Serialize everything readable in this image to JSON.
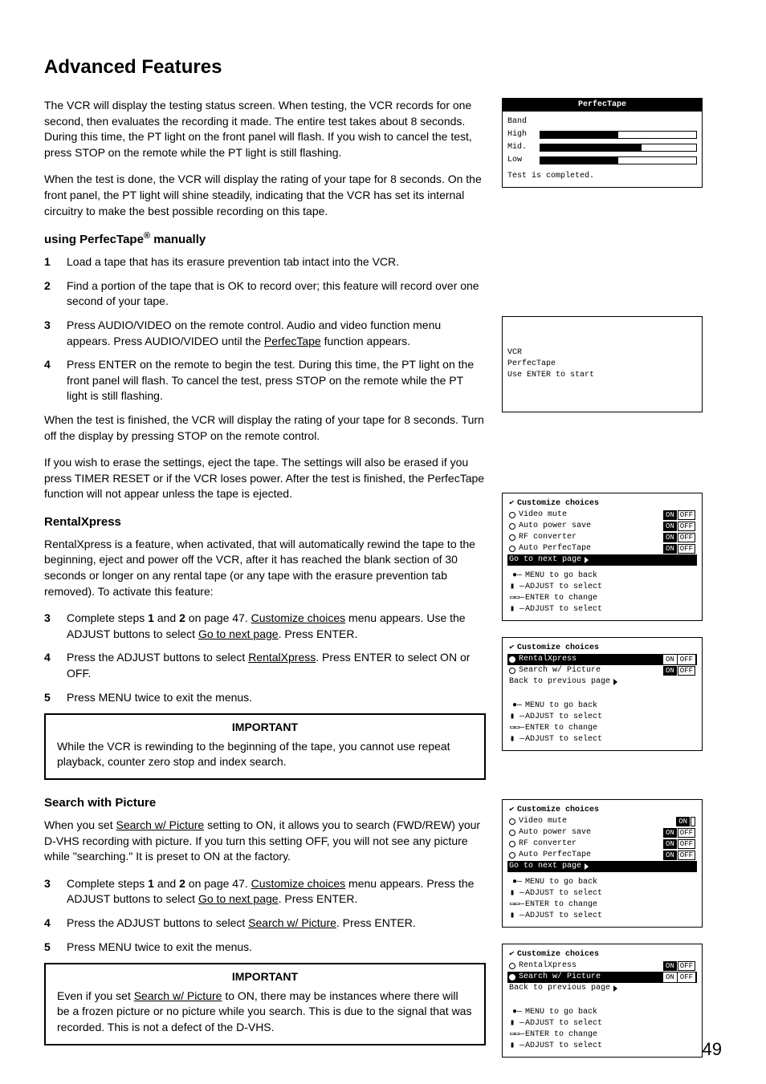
{
  "title": "Advanced Features",
  "page_number": "49",
  "intro": {
    "p1": "The VCR will display the testing status screen.  When testing, the VCR records for one second, then evaluates the recording it made.  The entire test takes about 8 seconds.  During this time, the PT light on the front panel will flash.  If you wish to cancel the test, press STOP on the remote while the PT light is still flashing.",
    "p2": "When the test is done, the VCR will display the rating of your tape for 8 seconds.  On the front panel, the PT light will shine steadily, indicating that the VCR has set its internal circuitry to make the best possible recording on this tape."
  },
  "perfectape": {
    "heading_prefix": "using PerfecTape",
    "reg": "®",
    "heading_suffix": " manually",
    "step1": "Load a tape that has its erasure prevention tab intact into the VCR.",
    "step2": "Find a portion of the tape that is OK to record over; this feature will record over one second of your tape.",
    "step3_pre": "Press AUDIO/VIDEO on the remote control.  Audio and video function menu appears.  Press AUDIO/VIDEO until the ",
    "step3_u": "PerfecTape",
    "step3_post": " function appears.",
    "step4": "Press ENTER on the remote to begin the test.  During this time, the PT light on the front panel will flash.  To cancel the test, press STOP on the remote while the PT light is still flashing.",
    "after1": "When the test is finished, the VCR will display the rating of your tape for 8 seconds.  Turn off the display by pressing STOP on the remote control.",
    "after2": "If you wish to erase the settings, eject the tape.  The settings will also be erased if you press TIMER RESET or if the VCR loses power.  After the test is finished, the PerfecTape function will not appear unless the tape is ejected."
  },
  "rentalxpress": {
    "heading": "RentalXpress",
    "intro": "RentalXpress is a feature, when activated, that will automatically rewind the tape to the beginning, eject and power off the VCR, after it has reached the blank section of 30 seconds or longer on any rental tape (or any tape with the erasure prevention tab removed).  To activate this feature:",
    "step3_pre": "Complete steps ",
    "step3_b1": "1",
    "step3_and": " and ",
    "step3_b2": "2",
    "step3_mid": " on page 47.  ",
    "step3_u1": "Customize choices",
    "step3_after_u1": " menu appears.  Use the ADJUST buttons to select ",
    "step3_u2": "Go to next page",
    "step3_end": ".  Press ENTER.",
    "step4_pre": "Press the ADJUST buttons to select ",
    "step4_u": "RentalXpress",
    "step4_post": ".  Press ENTER to select ON or OFF.",
    "step5": "Press MENU twice to exit the menus.",
    "important": "While the VCR is rewinding to the beginning of the tape, you cannot use repeat playback, counter zero stop and index search."
  },
  "search": {
    "heading": "Search with Picture",
    "intro_pre": "When you set ",
    "intro_u": "Search w/ Picture",
    "intro_post": " setting to ON, it allows you to search (FWD/REW) your D-VHS recording with picture.  If you turn this setting OFF, you will not see any picture while \"searching.\"  It is preset to ON at the factory.",
    "step3_pre": "Complete steps ",
    "step3_b1": "1",
    "step3_and": " and ",
    "step3_b2": "2",
    "step3_mid": " on page 47.  ",
    "step3_u1": "Customize choices",
    "step3_after_u1": " menu appears.  Press the ADJUST buttons to select ",
    "step3_u2": "Go to next page",
    "step3_end": ".  Press ENTER.",
    "step4_pre": "Press the ADJUST buttons to select ",
    "step4_u": "Search w/ Picture",
    "step4_post": ".  Press ENTER.",
    "step5": "Press MENU twice to exit the menus.",
    "important_pre": "Even if you set ",
    "important_u": "Search w/ Picture",
    "important_post": " to ON, there may be instances where there will be a frozen picture or no picture while you search.  This is due to the signal that was recorded.  This is not a defect of the D-VHS."
  },
  "important_label": "IMPORTANT",
  "nums": {
    "s1": "1",
    "s2": "2",
    "s3": "3",
    "s4": "4",
    "s5": "5"
  },
  "screens": {
    "pt": {
      "title": "PerfecTape",
      "band": "Band",
      "high": "High",
      "mid": "Mid.",
      "low": "Low",
      "done": "Test is completed."
    },
    "vcr": {
      "l1": "VCR",
      "l2": "PerfecTape",
      "l3": "Use ENTER to start"
    },
    "menu": {
      "header": "Customize choices",
      "video_mute": "Video mute",
      "auto_power": "Auto power save",
      "rf": "RF converter",
      "auto_pt": "Auto PerfecTape",
      "rentalxpress": "RentalXpress",
      "search": "Search w/ Picture",
      "next": "Go to next page",
      "prev": "Back to previous page",
      "on": "ON",
      "off": "OFF",
      "hint_menu": "MENU to go back",
      "hint_adjust": "ADJUST to select",
      "hint_enter": "ENTER  to change",
      "hint_adjust2": "ADJUST to select"
    }
  }
}
